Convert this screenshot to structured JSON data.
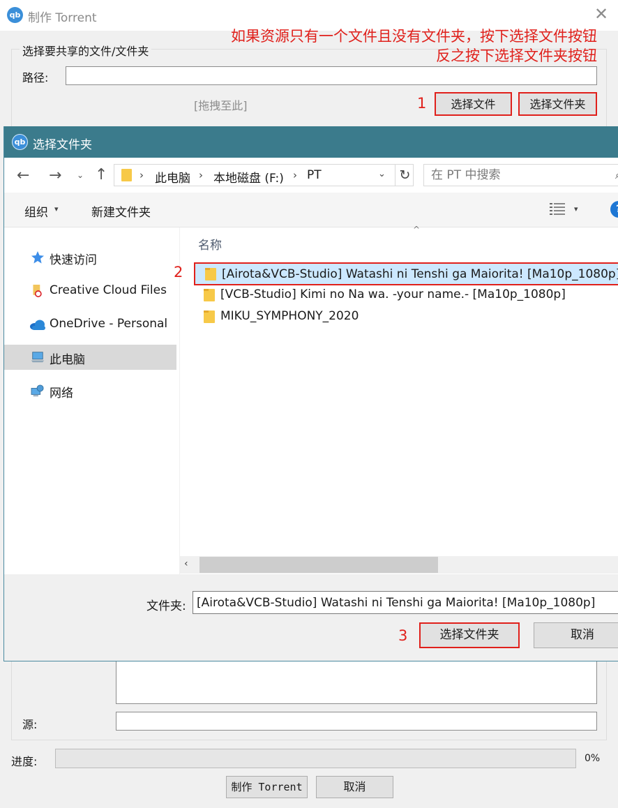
{
  "background_window": {
    "app_icon": "qb",
    "title": "制作 Torrent",
    "close_glyph": "✕",
    "group_legend": "选择要共享的文件/文件夹",
    "path_label": "路径:",
    "path_value": "",
    "drop_hint": "[拖拽至此]",
    "select_file_button": "选择文件",
    "select_folder_button": "选择文件夹",
    "source_label": "源:",
    "progress_label": "进度:",
    "progress_value": "0%",
    "progress_fraction": 0,
    "create_button": "制作 Torrent",
    "cancel_button": "取消"
  },
  "annotations": {
    "line1": "如果资源只有一个文件且没有文件夹，按下选择文件按钮",
    "line2": "反之按下选择文件夹按钮",
    "step1": "1",
    "step2": "2",
    "step3": "3",
    "highlight_color": "#e0201b"
  },
  "dialog": {
    "app_icon": "qb",
    "title": "选择文件夹",
    "nav": {
      "back_icon": "←",
      "forward_icon": "→",
      "recent_icon": "⌄",
      "up_icon": "↑",
      "breadcrumb": [
        "此电脑",
        "本地磁盘 (F:)",
        "PT"
      ],
      "crumb_separator": "›",
      "dropdown_icon": "⌄",
      "refresh_icon": "↻",
      "search_placeholder": "在 PT 中搜索",
      "search_icon": "⌕"
    },
    "commands": {
      "organize": "组织",
      "organize_caret": "▾",
      "new_folder": "新建文件夹",
      "view_caret": "▾",
      "help_glyph": "?"
    },
    "nav_pane": [
      {
        "label": "快速访问",
        "icon": "star-icon",
        "selected": false
      },
      {
        "label": "Creative Cloud Files",
        "icon": "creative-cloud-folder-icon",
        "selected": false
      },
      {
        "label": "OneDrive - Personal",
        "icon": "cloud-icon",
        "selected": false
      },
      {
        "label": "此电脑",
        "icon": "computer-icon",
        "selected": true
      },
      {
        "label": "网络",
        "icon": "network-icon",
        "selected": false
      }
    ],
    "list": {
      "sort_indicator": "^",
      "column_name": "名称",
      "items": [
        {
          "name": "[Airota&VCB-Studio] Watashi ni Tenshi ga Maiorita! [Ma10p_1080p]",
          "selected": true
        },
        {
          "name": "[VCB-Studio] Kimi no Na wa. -your name.- [Ma10p_1080p]",
          "selected": false
        },
        {
          "name": "MIKU_SYMPHONY_2020",
          "selected": false
        }
      ],
      "scroll_left_icon": "‹"
    },
    "folder_label": "文件夹:",
    "folder_value": "[Airota&VCB-Studio] Watashi ni Tenshi ga Maiorita! [Ma10p_1080p]",
    "select_folder_button": "选择文件夹",
    "cancel_button": "取消"
  }
}
